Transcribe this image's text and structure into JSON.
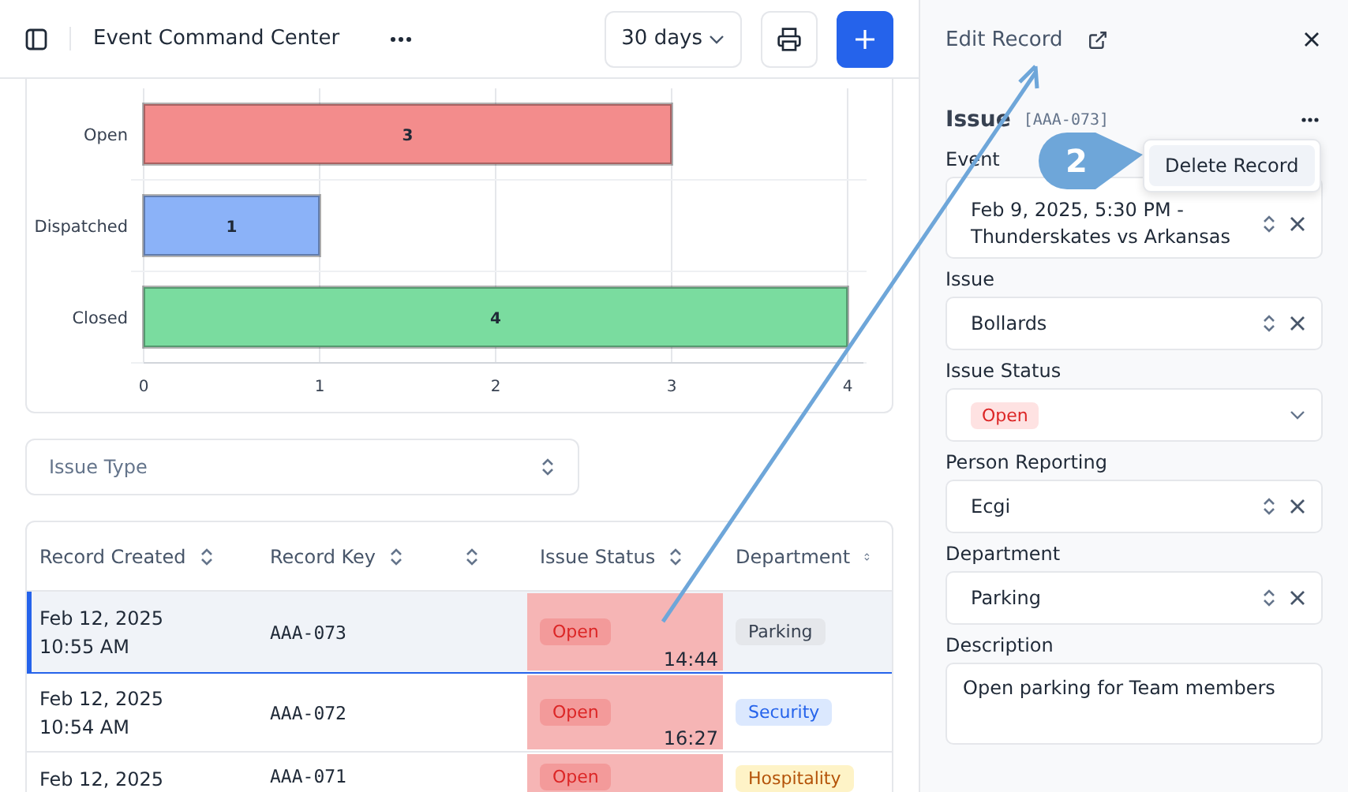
{
  "header": {
    "title": "Event Command Center",
    "range": "30 days"
  },
  "chart_data": {
    "type": "bar",
    "orientation": "horizontal",
    "grid": true,
    "categories": [
      "Open",
      "Dispatched",
      "Closed"
    ],
    "values": [
      3,
      1,
      4
    ],
    "colors": [
      "#f38c8c",
      "#8bb2f8",
      "#7adc9f"
    ],
    "xlim": [
      0,
      4
    ],
    "xticks": [
      0,
      1,
      2,
      3,
      4
    ],
    "data_labels": true
  },
  "filter": {
    "placeholder": "Issue Type"
  },
  "table": {
    "columns": [
      "Record Created",
      "Record Key",
      "",
      "Issue Status",
      "Department"
    ],
    "rows": [
      {
        "date": "Feb 12, 2025",
        "time": "10:55 AM",
        "key": "AAA-073",
        "status": "Open",
        "timer": "14:44",
        "department": "Parking",
        "color": "#e5e7eb",
        "selected": true
      },
      {
        "date": "Feb 12, 2025",
        "time": "10:54 AM",
        "key": "AAA-072",
        "status": "Open",
        "timer": "16:27",
        "department": "Security",
        "color": "#dbe8fe",
        "selected": false
      },
      {
        "date": "Feb 12, 2025",
        "key": "AAA-071",
        "status": "Open",
        "department": "Hospitality",
        "color": "#fef3c7",
        "selected": false
      }
    ]
  },
  "panel": {
    "title": "Edit Record",
    "section": "Issue",
    "record_key": "[AAA-073]",
    "menu": [
      "Delete Record"
    ],
    "step": "2",
    "fields": [
      {
        "label": "Event",
        "kind": "select",
        "value": "Feb 9, 2025, 5:30 PM - Thunderskates vs Arkansas"
      },
      {
        "label": "Issue",
        "kind": "select",
        "value": "Bollards"
      },
      {
        "label": "Issue Status",
        "kind": "status",
        "value": "Open"
      },
      {
        "label": "Person Reporting",
        "kind": "select",
        "value": "Ecgi"
      },
      {
        "label": "Department",
        "kind": "select",
        "value": "Parking"
      },
      {
        "label": "Description",
        "kind": "text",
        "value": "Open parking for Team members"
      }
    ]
  }
}
